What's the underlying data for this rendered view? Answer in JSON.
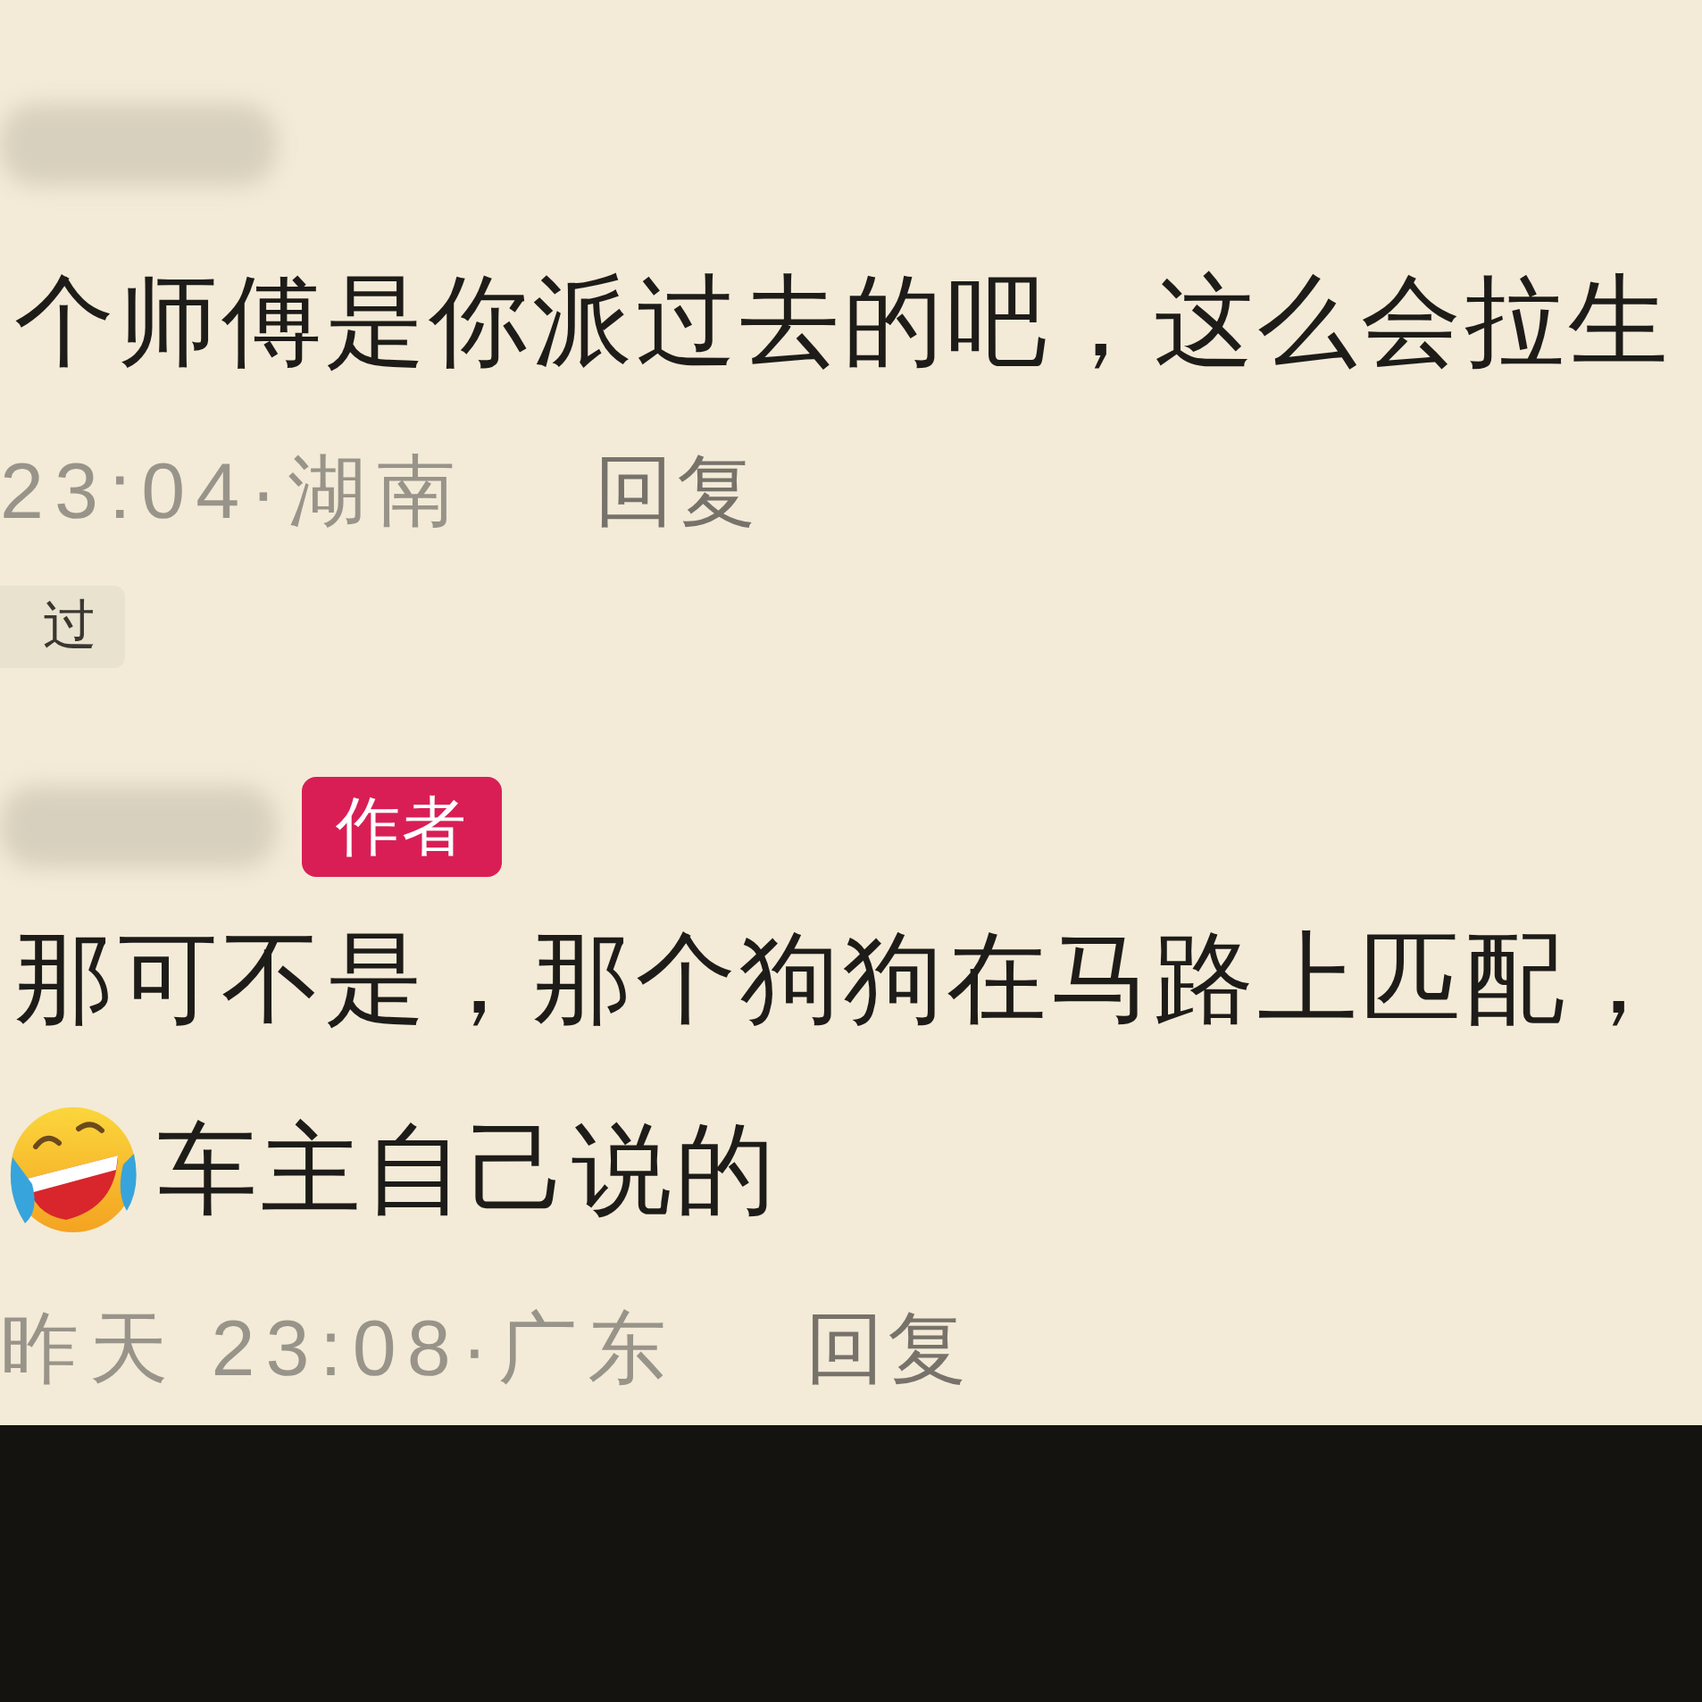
{
  "comments": [
    {
      "name_blurred": true,
      "lines": [
        {
          "emoji": false,
          "text": "个师傅是你派过去的吧，这么会拉生"
        }
      ],
      "meta": "23:04·湖南",
      "reply": "回复",
      "tag": "过"
    },
    {
      "name_blurred": true,
      "badge": "作者",
      "lines": [
        {
          "emoji": false,
          "text": "那可不是，那个狗狗在马路上匹配，"
        },
        {
          "emoji": true,
          "text": "车主自己说的"
        }
      ],
      "meta": "昨天 23:08·广东",
      "reply": "回复"
    }
  ]
}
